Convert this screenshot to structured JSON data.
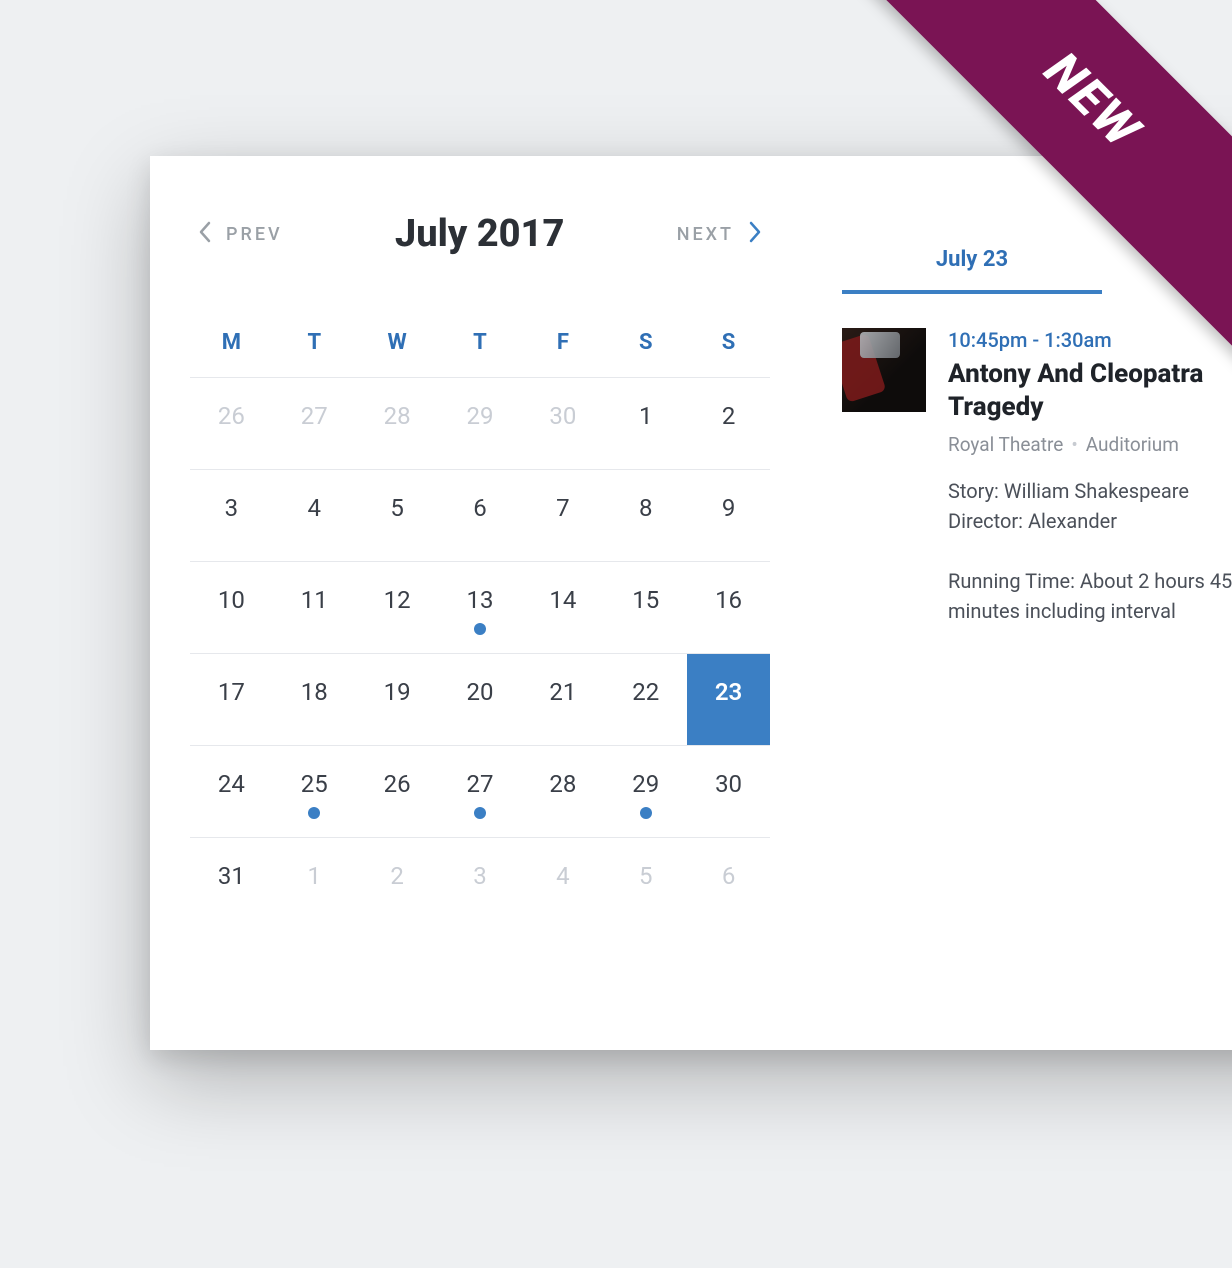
{
  "ribbon": {
    "label": "NEW"
  },
  "calendar": {
    "prev_label": "PREV",
    "next_label": "NEXT",
    "title": "July 2017",
    "weekdays": [
      "M",
      "T",
      "W",
      "T",
      "F",
      "S",
      "S"
    ],
    "days": [
      {
        "n": "26",
        "outside": true
      },
      {
        "n": "27",
        "outside": true
      },
      {
        "n": "28",
        "outside": true
      },
      {
        "n": "29",
        "outside": true
      },
      {
        "n": "30",
        "outside": true
      },
      {
        "n": "1"
      },
      {
        "n": "2"
      },
      {
        "n": "3"
      },
      {
        "n": "4"
      },
      {
        "n": "5"
      },
      {
        "n": "6"
      },
      {
        "n": "7"
      },
      {
        "n": "8"
      },
      {
        "n": "9"
      },
      {
        "n": "10"
      },
      {
        "n": "11"
      },
      {
        "n": "12"
      },
      {
        "n": "13",
        "hasEvent": true
      },
      {
        "n": "14"
      },
      {
        "n": "15"
      },
      {
        "n": "16"
      },
      {
        "n": "17"
      },
      {
        "n": "18"
      },
      {
        "n": "19"
      },
      {
        "n": "20"
      },
      {
        "n": "21"
      },
      {
        "n": "22"
      },
      {
        "n": "23",
        "selected": true
      },
      {
        "n": "24"
      },
      {
        "n": "25",
        "hasEvent": true
      },
      {
        "n": "26"
      },
      {
        "n": "27",
        "hasEvent": true
      },
      {
        "n": "28"
      },
      {
        "n": "29",
        "hasEvent": true
      },
      {
        "n": "30"
      },
      {
        "n": "31"
      },
      {
        "n": "1",
        "outside": true
      },
      {
        "n": "2",
        "outside": true
      },
      {
        "n": "3",
        "outside": true
      },
      {
        "n": "4",
        "outside": true
      },
      {
        "n": "5",
        "outside": true
      },
      {
        "n": "6",
        "outside": true
      }
    ]
  },
  "panel": {
    "selected_date": "July 23",
    "event": {
      "time": "10:45pm - 1:30am",
      "title_line1": "Antony And Cleopatra",
      "title_line2": "Tragedy",
      "venue": "Royal Theatre",
      "room": "Auditorium",
      "story": "Story: William Shakespeare",
      "director": "Director: Alexander",
      "running": "Running Time: About 2 hours 45",
      "running2": "minutes including interval"
    }
  }
}
